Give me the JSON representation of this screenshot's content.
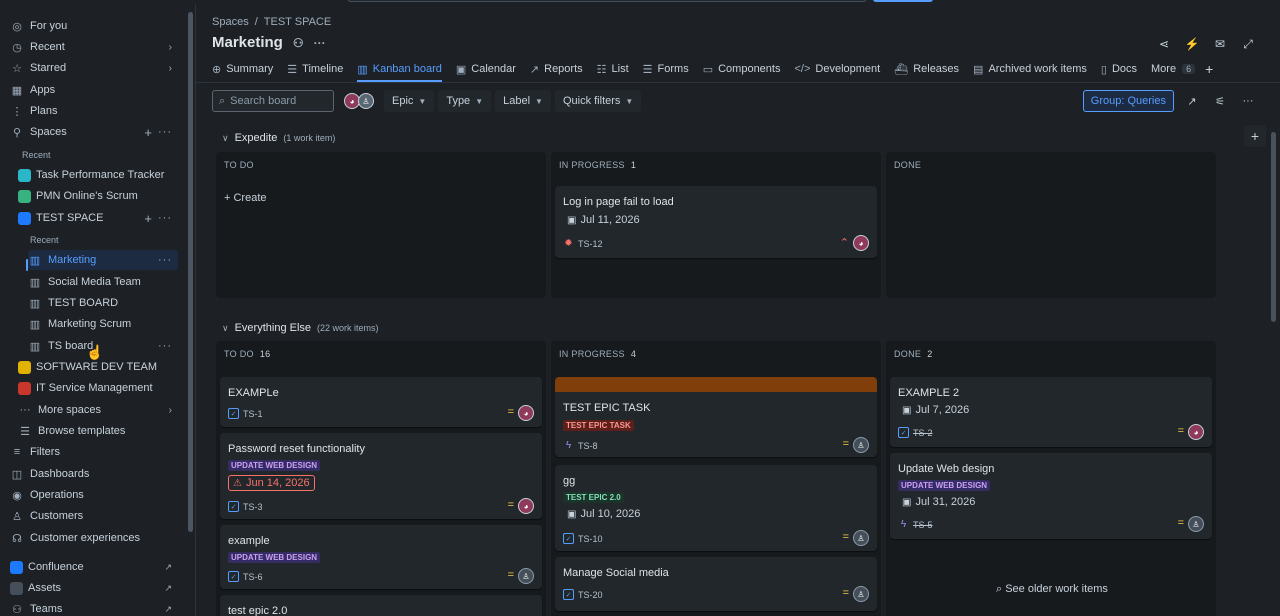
{
  "sidebar": {
    "for_you": "For you",
    "recent": "Recent",
    "starred": "Starred",
    "apps": "Apps",
    "plans": "Plans",
    "spaces": "Spaces",
    "recent_label": "Recent",
    "spaces_list": [
      {
        "name": "Task Performance Tracker",
        "color": "#2ab7ca"
      },
      {
        "name": "PMN Online's Scrum",
        "color": "#36b37e"
      },
      {
        "name": "TEST SPACE",
        "color": "#1d7afc"
      }
    ],
    "test_space_recent": "Recent",
    "boards": [
      "Marketing",
      "Social Media Team",
      "TEST BOARD",
      "Marketing Scrum",
      "TS board"
    ],
    "other_spaces": [
      {
        "name": "SOFTWARE DEV TEAM",
        "color": "#e2b203"
      },
      {
        "name": "IT Service Management",
        "color": "#c9372c"
      }
    ],
    "more_spaces": "More spaces",
    "browse_templates": "Browse templates",
    "filters": "Filters",
    "dashboards": "Dashboards",
    "operations": "Operations",
    "customers": "Customers",
    "customer_experiences": "Customer experiences",
    "confluence": "Confluence",
    "assets": "Assets",
    "teams": "Teams"
  },
  "header": {
    "breadcrumb": [
      "Spaces",
      "/",
      "TEST SPACE"
    ],
    "title": "Marketing"
  },
  "tabs": [
    {
      "label": "Summary",
      "icon": "globe-icon"
    },
    {
      "label": "Timeline",
      "icon": "timeline-icon"
    },
    {
      "label": "Kanban board",
      "icon": "board-icon",
      "active": true
    },
    {
      "label": "Calendar",
      "icon": "calendar-icon"
    },
    {
      "label": "Reports",
      "icon": "chart-icon"
    },
    {
      "label": "List",
      "icon": "list-icon"
    },
    {
      "label": "Forms",
      "icon": "forms-icon"
    },
    {
      "label": "Components",
      "icon": "components-icon"
    },
    {
      "label": "Development",
      "icon": "code-icon"
    },
    {
      "label": "Releases",
      "icon": "ship-icon"
    },
    {
      "label": "Archived work items",
      "icon": "archive-icon"
    },
    {
      "label": "Docs",
      "icon": "doc-icon"
    }
  ],
  "more_tab": {
    "label": "More",
    "count": "6"
  },
  "toolbar": {
    "search_placeholder": "Search board",
    "filters": [
      "Epic",
      "Type",
      "Label",
      "Quick filters"
    ],
    "group": "Group: Queries"
  },
  "swimlanes": {
    "expedite": {
      "title": "Expedite",
      "count": "(1 work item)"
    },
    "else": {
      "title": "Everything Else",
      "count": "(22 work items)"
    }
  },
  "columns": {
    "todo": "TO DO",
    "inprogress": "IN PROGRESS",
    "done": "DONE"
  },
  "expedite": {
    "inprogress_count": "1",
    "create": "Create",
    "card": {
      "title": "Log in page fail to load",
      "date": "Jul 11, 2026",
      "key": "TS-12"
    }
  },
  "everything": {
    "todo_count": "16",
    "inprogress_count": "4",
    "done_count": "2",
    "todo_cards": [
      {
        "title": "EXAMPLe",
        "key": "TS-1"
      },
      {
        "title": "Password reset functionality",
        "label": "UPDATE WEB DESIGN",
        "date": "Jun 14, 2026",
        "key": "TS-3"
      },
      {
        "title": "example",
        "label": "UPDATE WEB DESIGN",
        "key": "TS-6"
      },
      {
        "title": "test epic 2.0"
      }
    ],
    "inprogress_cards": [
      {
        "title": "TEST EPIC TASK",
        "label": "TEST EPIC TASK",
        "key": "TS-8"
      },
      {
        "title": "gg",
        "label": "TEST EPIC 2.0",
        "date": "Jul 10, 2026",
        "key": "TS-10"
      },
      {
        "title": "Manage Social media",
        "key": "TS-20"
      }
    ],
    "done_cards": [
      {
        "title": "EXAMPLE 2",
        "date": "Jul 7, 2026",
        "key": "TS-2"
      },
      {
        "title": "Update Web design",
        "label": "UPDATE WEB DESIGN",
        "date": "Jul 31, 2026",
        "key": "TS-5"
      }
    ],
    "older": "See older work items"
  }
}
